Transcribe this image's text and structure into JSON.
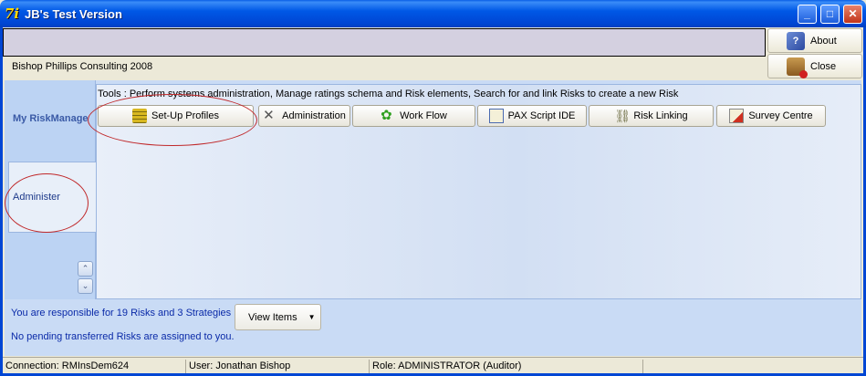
{
  "window": {
    "title": "JB's Test Version",
    "app_icon": "7i",
    "minimize_symbol": "_",
    "maximize_symbol": "□",
    "close_symbol": "✕"
  },
  "side_buttons": {
    "about_label": "About",
    "close_label": "Close"
  },
  "company": "Bishop Phillips Consulting 2008",
  "tabs": {
    "myrisk_label": "My RiskManage",
    "admin_label": "Administer",
    "scroll_up": "⌃",
    "scroll_down": "⌄"
  },
  "tools_description": "Tools : Perform systems administration, Manage ratings schema and Risk elements, Search for and link Risks to create a new Risk",
  "tool_buttons": [
    {
      "label": "Set-Up Profiles",
      "icon": "stack-icon"
    },
    {
      "label": "Administration",
      "icon": "tools-icon"
    },
    {
      "label": "Work Flow",
      "icon": "gears-icon"
    },
    {
      "label": "PAX Script IDE",
      "icon": "script-icon"
    },
    {
      "label": "Risk Linking",
      "icon": "chain-icon"
    },
    {
      "label": "Survey Centre",
      "icon": "pencil-icon"
    }
  ],
  "bottom": {
    "responsible_text": "You are responsible for 19 Risks and 3 Strategies",
    "pending_text": "No pending transferred Risks are assigned to you.",
    "view_items_label": "View Items",
    "view_items_caret": "▼"
  },
  "status": {
    "connection": "Connection: RMInsDem624",
    "user": "User: Jonathan Bishop",
    "role": "Role: ADMINISTRATOR (Auditor)"
  },
  "colors": {
    "titlebar": "#0058e6",
    "annotation_circle": "#c0282a",
    "link_text": "#0a2aa8"
  }
}
